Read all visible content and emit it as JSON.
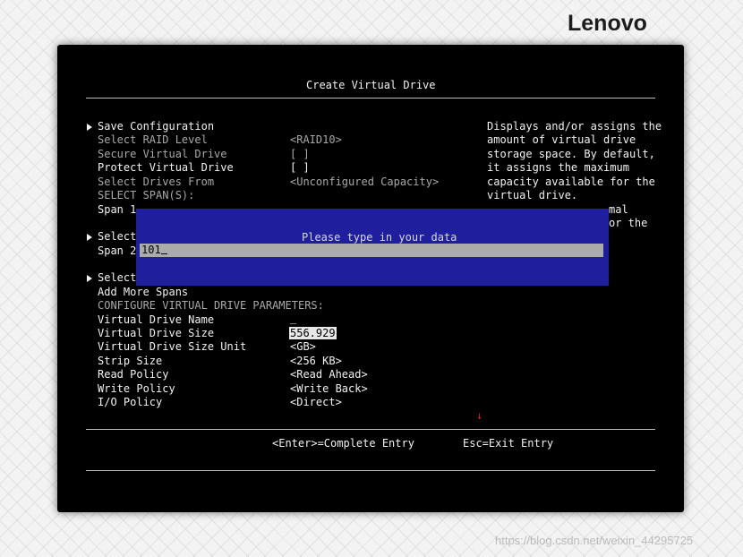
{
  "brand": {
    "logo": "Lenovo",
    "watermark": "https://blog.csdn.net/weixin_44295725"
  },
  "header": {
    "title": "Create Virtual Drive"
  },
  "menu": {
    "save_configuration": "Save Configuration",
    "select_raid_level": {
      "label": "Select RAID Level",
      "value": "<RAID10>"
    },
    "secure_virtual_drive": {
      "label": "Secure Virtual Drive",
      "value": "[ ]"
    },
    "protect_virtual_drive": {
      "label": "Protect Virtual Drive",
      "value": "[ ]"
    },
    "select_drives_from": {
      "label": "Select Drives From",
      "value": "<Unconfigured Capacity>"
    },
    "select_spans_header": "SELECT SPAN(S):",
    "span1": "Span 1",
    "select_a": "Select",
    "span2": "Span 2",
    "select_b": "Select",
    "add_more_spans": "Add More Spans",
    "params_header": "CONFIGURE VIRTUAL DRIVE PARAMETERS:",
    "virtual_drive_name": {
      "label": "Virtual Drive Name",
      "value": "_"
    },
    "virtual_drive_size": {
      "label": "Virtual Drive Size",
      "value": "556.929"
    },
    "size_unit": {
      "label": "Virtual Drive Size Unit",
      "value": "<GB>"
    },
    "strip_size": {
      "label": "Strip Size",
      "value": "<256 KB>"
    },
    "read_policy": {
      "label": "Read Policy",
      "value": "<Read Ahead>"
    },
    "write_policy": {
      "label": "Write Policy",
      "value": "<Write Back>"
    },
    "io_policy": {
      "label": "I/O Policy",
      "value": "<Direct>"
    }
  },
  "help": {
    "lines": [
      "Displays and/or assigns the",
      "amount of virtual drive",
      "storage space. By default,",
      "it assigns the maximum",
      "capacity available for the",
      "virtual drive."
    ],
    "fragment1": "mal",
    "fragment2": "or the"
  },
  "dialog": {
    "prompt": "Please type in your data",
    "input_value": "101"
  },
  "footer": {
    "enter_hint": "<Enter>=Complete Entry",
    "esc_hint": "Esc=Exit Entry"
  },
  "colors": {
    "screen_bg": "#000000",
    "dialog_bg": "#1f1f9e",
    "input_bg": "#ababab",
    "text": "#f2f2f2",
    "dim_text": "#a8a8a8"
  }
}
